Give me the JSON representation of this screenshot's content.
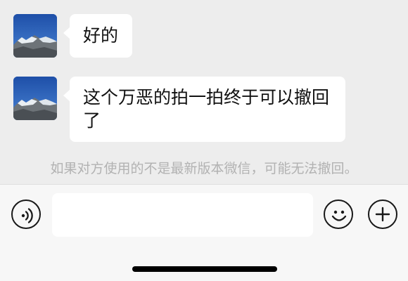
{
  "messages": [
    {
      "text": "好的",
      "avatar_icon": "mountain-avatar-icon"
    },
    {
      "text": "这个万恶的拍一拍终于可以撤回了",
      "avatar_icon": "mountain-avatar-icon"
    }
  ],
  "system_notice": "如果对方使用的不是最新版本微信，可能无法撤回。",
  "input_bar": {
    "message_input_value": "",
    "voice_icon": "voice-icon",
    "emoji_icon": "emoji-icon",
    "plus_icon": "plus-icon"
  },
  "colors": {
    "chat_background": "#ededed",
    "bubble": "#ffffff",
    "notice_text": "#b2b2b2",
    "input_bar_background": "#f7f7f7"
  }
}
